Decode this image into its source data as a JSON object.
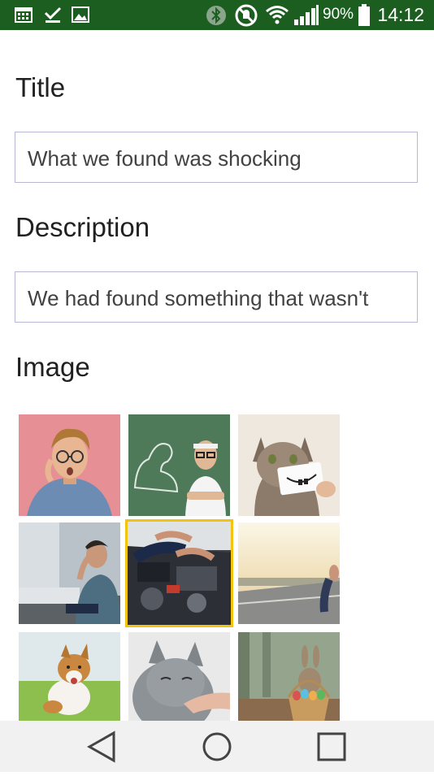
{
  "status_bar": {
    "battery_percent": "90%",
    "time": "14:12",
    "left_icons": [
      "calendar-icon",
      "task-check-icon",
      "gallery-icon"
    ],
    "right_icons": [
      "bluetooth-icon",
      "mute-icon",
      "wifi-icon",
      "signal-icon",
      "battery-icon"
    ]
  },
  "form": {
    "title_label": "Title",
    "title_value": "What we found was shocking",
    "description_label": "Description",
    "description_value": "We had found something that wasn't",
    "image_label": "Image"
  },
  "images": [
    {
      "name": "surprised-man-glasses",
      "selected": false
    },
    {
      "name": "chalkboard-muscle-man",
      "selected": false
    },
    {
      "name": "cat-with-smile-card",
      "selected": false
    },
    {
      "name": "stressed-man-couch",
      "selected": false
    },
    {
      "name": "car-engine-repair",
      "selected": true
    },
    {
      "name": "sunset-road",
      "selected": false
    },
    {
      "name": "running-puppy",
      "selected": false
    },
    {
      "name": "grey-cat-hand",
      "selected": false
    },
    {
      "name": "bunny-easter-basket",
      "selected": false
    }
  ],
  "navigation_bar": {
    "buttons": [
      "back-icon",
      "home-icon",
      "recents-icon"
    ]
  },
  "colors": {
    "status_bar": "#1b5e20",
    "selection_border": "#f2c40f",
    "field_border": "#b8b8d6",
    "nav_bar": "#f1f1f1"
  }
}
